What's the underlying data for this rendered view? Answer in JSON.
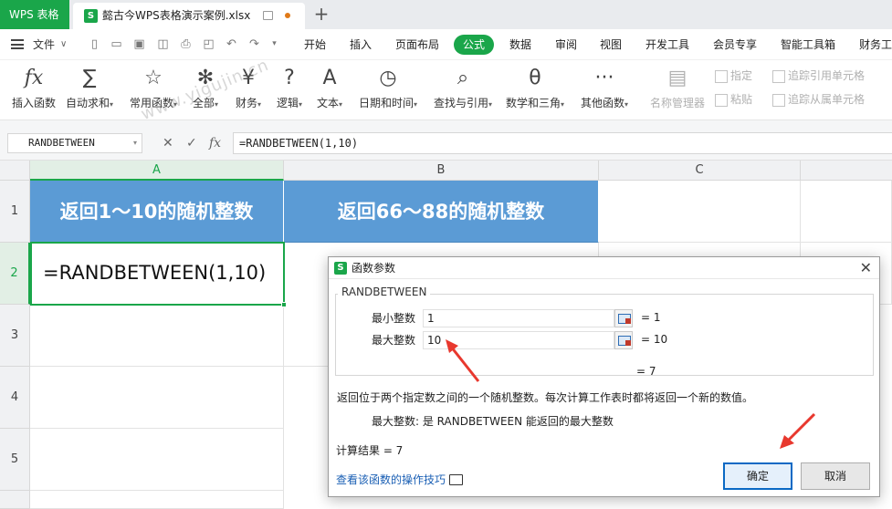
{
  "titlebar": {
    "app_tab": "WPS 表格",
    "doc_name": "懿古今WPS表格演示案例.xlsx",
    "new_tab": "+"
  },
  "menubar": {
    "file": "文件",
    "items": [
      "开始",
      "插入",
      "页面布局",
      "公式",
      "数据",
      "审阅",
      "视图",
      "开发工具",
      "会员专享",
      "智能工具箱",
      "财务工"
    ],
    "active": "公式"
  },
  "ribbon": {
    "buttons": [
      {
        "icon": "fx",
        "label": "插入函数"
      },
      {
        "icon": "∑",
        "label": "自动求和"
      },
      {
        "icon": "☆",
        "label": "常用函数"
      },
      {
        "icon": "✻",
        "label": "全部"
      },
      {
        "icon": "¥",
        "label": "财务"
      },
      {
        "icon": "?",
        "label": "逻辑"
      },
      {
        "icon": "A",
        "label": "文本"
      },
      {
        "icon": "◷",
        "label": "日期和时间"
      },
      {
        "icon": "⌕",
        "label": "查找与引用"
      },
      {
        "icon": "θ",
        "label": "数学和三角"
      },
      {
        "icon": "···",
        "label": "其他函数"
      },
      {
        "icon": "▤",
        "label": "名称管理器"
      }
    ],
    "small": [
      "指定",
      "粘贴",
      "追踪引用单元格",
      "追踪从属单元格"
    ]
  },
  "formula_bar": {
    "name_box": "RANDBETWEEN",
    "fx": "fx",
    "formula": "=RANDBETWEEN(1,10)"
  },
  "sheet": {
    "columns": [
      "A",
      "B",
      "C"
    ],
    "rows": [
      "1",
      "2",
      "3",
      "4",
      "5"
    ],
    "a1": "返回1～10的随机整数",
    "b1": "返回66～88的随机整数",
    "a2": "=RANDBETWEEN(1,10)"
  },
  "watermark": "www.yigujin.cn",
  "dialog": {
    "title": "函数参数",
    "function_name": "RANDBETWEEN",
    "args": [
      {
        "label": "最小整数",
        "value": "1",
        "result": "=  1"
      },
      {
        "label": "最大整数",
        "value": "10",
        "result": "=  10"
      }
    ],
    "total": "=  7",
    "description": "返回位于两个指定数之间的一个随机整数。每次计算工作表时都将返回一个新的数值。",
    "arg_help": "最大整数:  是 RANDBETWEEN 能返回的最大整数",
    "calc_result": "计算结果  =  7",
    "help_link": "查看该函数的操作技巧",
    "ok": "确定",
    "cancel": "取消"
  },
  "colors": {
    "brand": "#1aa64a",
    "header_fill": "#5b9bd5",
    "arrow": "#e8382e"
  }
}
